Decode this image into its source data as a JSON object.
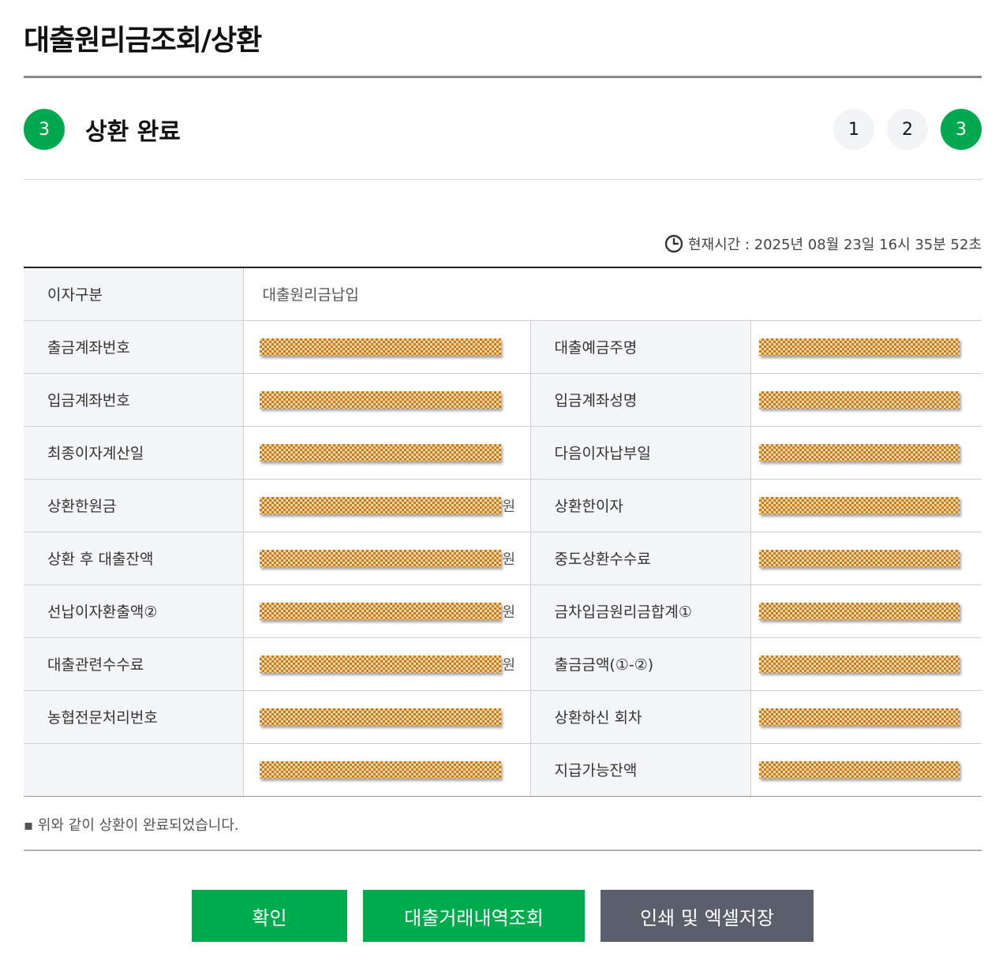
{
  "header": {
    "title": "대출원리금조회/상환"
  },
  "step": {
    "current_number": "3",
    "title": "상환 완료",
    "nav": [
      "1",
      "2",
      "3"
    ],
    "active_index": 2
  },
  "time": {
    "label": "현재시간 : 2025년 08월 23일 16시 35분 52초"
  },
  "table": {
    "first_row": {
      "label": "이자구분",
      "value": "대출원리금납입"
    },
    "rows": [
      {
        "left_label": "출금계좌번호",
        "left_suffix": "",
        "right_label": "대출예금주명",
        "right_suffix": ""
      },
      {
        "left_label": "입금계좌번호",
        "left_suffix": "",
        "right_label": "입금계좌성명",
        "right_suffix": ""
      },
      {
        "left_label": "최종이자계산일",
        "left_suffix": "",
        "right_label": "다음이자납부일",
        "right_suffix": ""
      },
      {
        "left_label": "상환한원금",
        "left_suffix": "원",
        "right_label": "상환한이자",
        "right_suffix": ""
      },
      {
        "left_label": "상환 후 대출잔액",
        "left_suffix": "원",
        "right_label": "중도상환수수료",
        "right_suffix": ""
      },
      {
        "left_label": "선납이자환출액②",
        "left_suffix": "원",
        "right_label": "금차입금원리금합계①",
        "right_suffix": ""
      },
      {
        "left_label": "대출관련수수료",
        "left_suffix": "원",
        "right_label": "출금금액(①-②)",
        "right_suffix": ""
      },
      {
        "left_label": "농협전문처리번호",
        "left_suffix": "",
        "right_label": "상환하신 회차",
        "right_suffix": ""
      },
      {
        "left_label": "",
        "left_suffix": "",
        "right_label": "지급가능잔액",
        "right_suffix": ""
      }
    ]
  },
  "note": "▪ 위와 같이 상환이 완료되었습니다.",
  "buttons": {
    "confirm": "확인",
    "history": "대출거래내역조회",
    "print": "인쇄 및 엑셀저장"
  },
  "icons": {
    "clock": "clock-icon"
  },
  "colors": {
    "accent": "#00a94f",
    "button_gray": "#5a5f6b"
  }
}
